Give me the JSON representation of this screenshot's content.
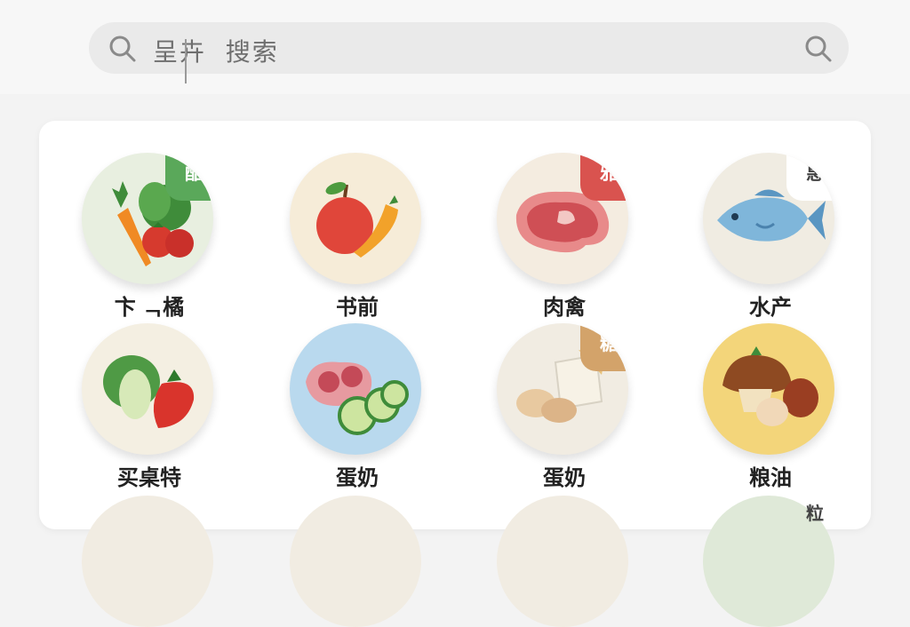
{
  "search": {
    "text": "呈卉  搜索"
  },
  "categories": [
    {
      "label": "卞 ᆨ橘",
      "badge": "酷",
      "badge_color": "#5aa85a",
      "bg": "#e8efe0",
      "icon": "vegetables-icon"
    },
    {
      "label": "书前",
      "badge": "",
      "badge_color": "",
      "bg": "#f6ecd8",
      "icon": "apple-carrot-icon"
    },
    {
      "label": "肉禽",
      "badge": "雅",
      "badge_color": "#d9534f",
      "bg": "#f4ece0",
      "icon": "steak-icon"
    },
    {
      "label": "水产",
      "badge": "惠",
      "badge_color": "#ffffff",
      "bg": "#f0ece2",
      "icon": "fish-icon"
    },
    {
      "label": "买桌特",
      "badge": "",
      "badge_color": "",
      "bg": "#f4efe2",
      "icon": "lettuce-strawberry-icon"
    },
    {
      "label": "蛋奶",
      "badge": "",
      "badge_color": "",
      "bg": "#b9d9ee",
      "icon": "meat-cucumber-icon"
    },
    {
      "label": "蛋奶",
      "badge": "糖",
      "badge_color": "#d3a36a",
      "bg": "#f1ece2",
      "icon": "bread-cheese-icon"
    },
    {
      "label": "粮油",
      "badge": "",
      "badge_color": "",
      "bg": "#f3d57a",
      "icon": "mushroom-icon"
    }
  ],
  "next_row_badge": "粒"
}
